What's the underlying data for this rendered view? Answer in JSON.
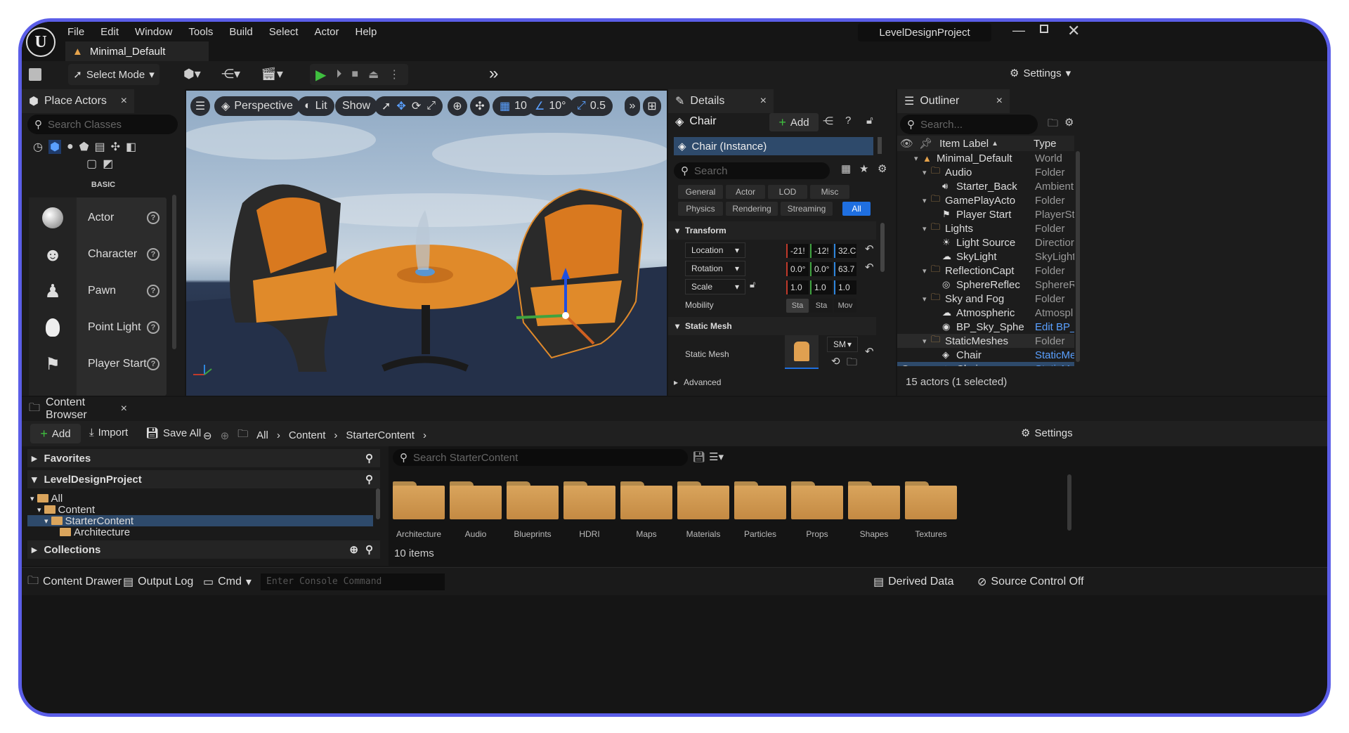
{
  "menu": {
    "items": [
      "File",
      "Edit",
      "Window",
      "Tools",
      "Build",
      "Select",
      "Actor",
      "Help"
    ],
    "project": "LevelDesignProject"
  },
  "level_tab": "Minimal_Default",
  "toolbar": {
    "select_mode": "Select Mode",
    "settings": "Settings"
  },
  "place_actors": {
    "title": "Place Actors",
    "search_placeholder": "Search Classes",
    "category": "BASIC",
    "items": [
      "Actor",
      "Character",
      "Pawn",
      "Point Light",
      "Player Start"
    ]
  },
  "viewport": {
    "perspective": "Perspective",
    "lit": "Lit",
    "show": "Show",
    "grid": "10",
    "angle": "10°",
    "scale": "0.5"
  },
  "details": {
    "title": "Details",
    "object": "Chair",
    "add": "Add",
    "instance": "Chair (Instance)",
    "search_placeholder": "Search",
    "filters_row1": [
      "General",
      "Actor",
      "LOD",
      "Misc"
    ],
    "filters_row2": [
      "Physics",
      "Rendering",
      "Streaming",
      "All"
    ],
    "transform_header": "Transform",
    "location": {
      "label": "Location",
      "x": "-21!",
      "y": "-12!",
      "z": "32.C"
    },
    "rotation": {
      "label": "Rotation",
      "x": "0.0°",
      "y": "0.0°",
      "z": "63.7"
    },
    "scale": {
      "label": "Scale",
      "x": "1.0",
      "y": "1.0",
      "z": "1.0"
    },
    "mobility": {
      "label": "Mobility",
      "options": [
        "Sta",
        "Sta",
        "Mov"
      ]
    },
    "static_mesh_header": "Static Mesh",
    "static_mesh_label": "Static Mesh",
    "mesh_dropdown": "SM",
    "advanced": "Advanced"
  },
  "outliner": {
    "title": "Outliner",
    "search_placeholder": "Search...",
    "col_label": "Item Label",
    "col_type": "Type",
    "rows": [
      {
        "name": "Minimal_Default",
        "type": "World"
      },
      {
        "name": "Audio",
        "type": "Folder"
      },
      {
        "name": "Starter_Back",
        "type": "Ambient"
      },
      {
        "name": "GamePlayActo",
        "type": "Folder"
      },
      {
        "name": "Player Start",
        "type": "PlayerSt"
      },
      {
        "name": "Lights",
        "type": "Folder"
      },
      {
        "name": "Light Source",
        "type": "Directior"
      },
      {
        "name": "SkyLight",
        "type": "SkyLight"
      },
      {
        "name": "ReflectionCapt",
        "type": "Folder"
      },
      {
        "name": "SphereReflec",
        "type": "SphereR"
      },
      {
        "name": "Sky and Fog",
        "type": "Folder"
      },
      {
        "name": "Atmospheric",
        "type": "Atmospl"
      },
      {
        "name": "BP_Sky_Sphe",
        "type": "Edit BP_"
      },
      {
        "name": "StaticMeshes",
        "type": "Folder"
      },
      {
        "name": "Chair",
        "type": "StaticMe"
      },
      {
        "name": "Chair",
        "type": "StaticMe"
      }
    ],
    "status": "15 actors (1 selected)"
  },
  "content_browser": {
    "title": "Content Browser",
    "add": "Add",
    "import": "Import",
    "save_all": "Save All",
    "path": [
      "All",
      "Content",
      "StarterContent"
    ],
    "settings": "Settings",
    "favorites": "Favorites",
    "project": "LevelDesignProject",
    "tree": [
      "All",
      "Content",
      "StarterContent",
      "Architecture"
    ],
    "collections": "Collections",
    "search_placeholder": "Search StarterContent",
    "folders": [
      "Architecture",
      "Audio",
      "Blueprints",
      "HDRI",
      "Maps",
      "Materials",
      "Particles",
      "Props",
      "Shapes",
      "Textures"
    ],
    "count": "10 items"
  },
  "statusbar": {
    "content_drawer": "Content Drawer",
    "output_log": "Output Log",
    "cmd": "Cmd",
    "console_placeholder": "Enter Console Command",
    "derived_data": "Derived Data",
    "source_control": "Source Control Off"
  },
  "colors": {
    "accent": "#1f6fe0",
    "selection": "#2e4a6b",
    "frame": "#5b5ee8",
    "folder": "#d9a45c",
    "chair": "#e08a2a"
  }
}
